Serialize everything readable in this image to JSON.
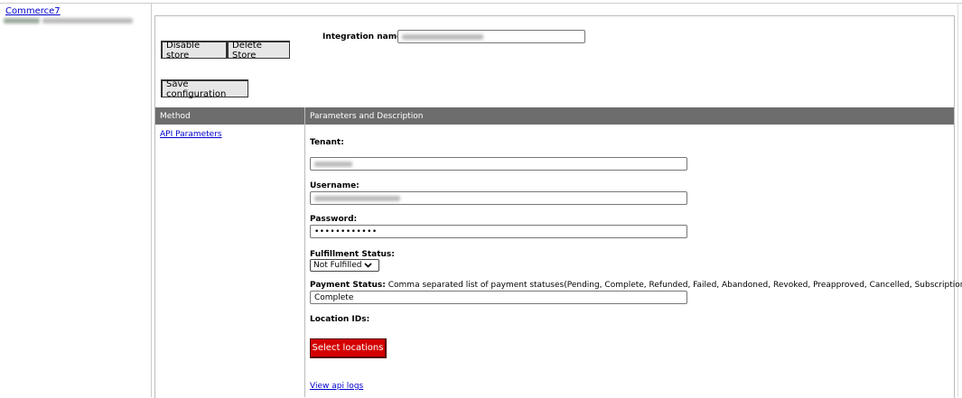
{
  "sidebar": {
    "store_link": "Commerce7"
  },
  "toolbar": {
    "disable_label": "Disable store",
    "delete_label": "Delete Store",
    "save_label": "Save configuration"
  },
  "integration": {
    "name_label": "Integration name:"
  },
  "table": {
    "col_method": "Method",
    "col_params": "Parameters and Description",
    "method_link": "API Parameters"
  },
  "params": {
    "tenant_label": "Tenant:",
    "username_label": "Username:",
    "password_label": "Password:",
    "password_value": "••••••••••••",
    "fulfillment_label": "Fulfillment Status:",
    "fulfillment_value": "Not Fulfilled",
    "payment_label": "Payment Status:",
    "payment_desc": "Comma separated list of payment statuses(Pending, Complete, Refunded, Failed, Abandoned, Revoked, Preapproved, Cancelled, Subscription, Other)",
    "payment_value": "Complete",
    "location_label": "Location IDs:",
    "select_locations": "Select locations",
    "view_logs": "View api logs"
  },
  "colors": {
    "header_bg": "#6d6d6d",
    "link": "#0000cc",
    "red_button": "#d40000"
  }
}
